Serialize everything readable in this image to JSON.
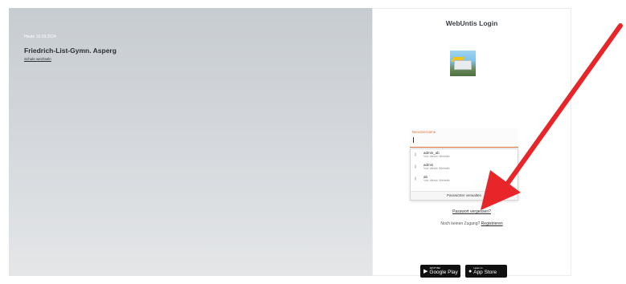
{
  "left": {
    "date": "Heute 16.09.2024",
    "school_name": "Friedrich-List-Gymn. Asperg",
    "switch_school": "Schule wechseln"
  },
  "login": {
    "title": "WebUntis Login",
    "username_label": "Benutzername",
    "username_value": "",
    "suggestions": [
      {
        "name": "admin_ab",
        "sub": "Von dieser Website"
      },
      {
        "name": "admin",
        "sub": "Von dieser Website"
      },
      {
        "name": "ab",
        "sub": "Von dieser Website"
      }
    ],
    "manage_passwords": "Passwörter verwalten",
    "forgot_password": "Passwort vergessen?",
    "no_access": "Noch keinen Zugang?",
    "register": "Registrieren"
  },
  "stores": {
    "google_small": "JETZT BEI",
    "google_big": "Google Play",
    "apple_small": "Laden im",
    "apple_big": "App Store"
  },
  "colors": {
    "accent": "#e0703c",
    "annotation_arrow": "#e8262a"
  },
  "icons": {
    "key": "key-icon",
    "google_play": "google-play-icon",
    "apple": "apple-icon"
  }
}
